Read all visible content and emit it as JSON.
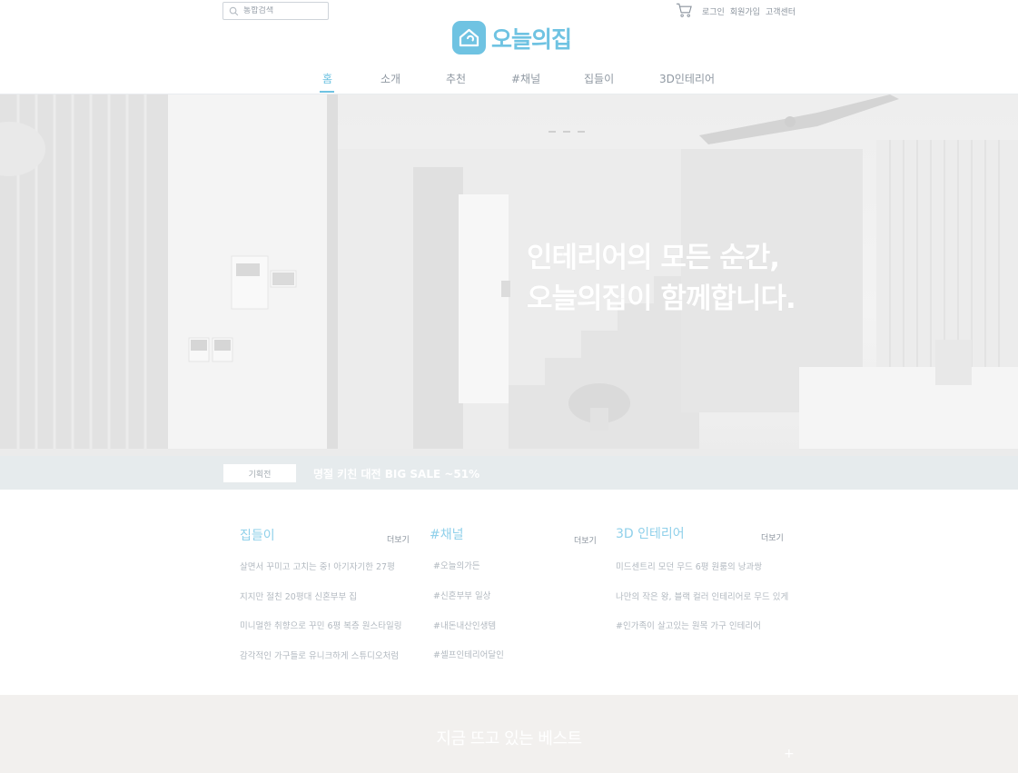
{
  "header": {
    "search_placeholder": "통합검색",
    "util_links": [
      "로그인",
      "회원가입",
      "고객센터"
    ],
    "logo_text": "오늘의집",
    "nav": [
      {
        "label": "홈",
        "active": true
      },
      {
        "label": "소개",
        "active": false
      },
      {
        "label": "추천",
        "active": false
      },
      {
        "label": "#채널",
        "active": false
      },
      {
        "label": "집들이",
        "active": false
      },
      {
        "label": "3D인테리어",
        "active": false
      }
    ],
    "accent_color": "#6fc3e2"
  },
  "hero": {
    "headline_line1": "인테리어의 모든 순간,",
    "headline_line2": "오늘의집이 함께합니다."
  },
  "promo": {
    "badge": "기획전",
    "text": "명절 키친 대전 BIG SALE  ~51%"
  },
  "sections": [
    {
      "title": "집들이",
      "more": "더보기",
      "items": [
        "살면서 꾸미고 고치는 중! 아기자기한 27평",
        "지지만 절친 20평대 신혼부부 집",
        "미니멀한 취향으로 꾸민 6평 복층 원스타일링",
        "감각적인 가구들로 유니크하게 스튜디오처럼"
      ]
    },
    {
      "title": "#채널",
      "more": "더보기",
      "items": [
        "#오늘의가든",
        "#신혼부부 일상",
        "#내돈내산인생템",
        "#셀프인테리어달인"
      ]
    },
    {
      "title": "3D 인테리어",
      "more": "더보기",
      "items": [
        "미드센트리 모던 무드 6평 원룸의 낭과쌍",
        "나만의 작은 왕, 블랙 컬러 인테리어로 무드 있게",
        "#인가족이 살고있는 원목 가구 인테리어"
      ]
    }
  ],
  "best": {
    "title": "지금  뜨고 있는 베스트",
    "plus": "+"
  }
}
